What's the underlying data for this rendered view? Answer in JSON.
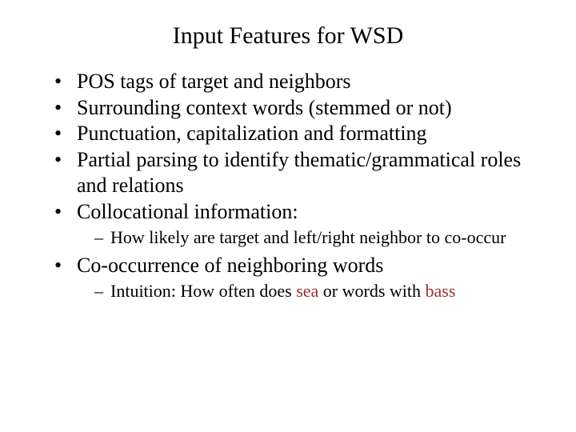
{
  "title": "Input Features for WSD",
  "bullets": {
    "b1": "POS tags of target and neighbors",
    "b2": "Surrounding context words (stemmed or not)",
    "b3": "Punctuation, capitalization and formatting",
    "b4": "Partial parsing to identify thematic/grammatical roles and relations",
    "b5": "Collocational information:",
    "b5sub1": "How likely are target and left/right neighbor to co-occur",
    "b6": "Co-occurrence of neighboring words",
    "b6sub1_pre": "Intuition:  How often does ",
    "b6sub1_hl1": "sea",
    "b6sub1_mid": " or words with ",
    "b6sub1_hl2": "bass"
  }
}
